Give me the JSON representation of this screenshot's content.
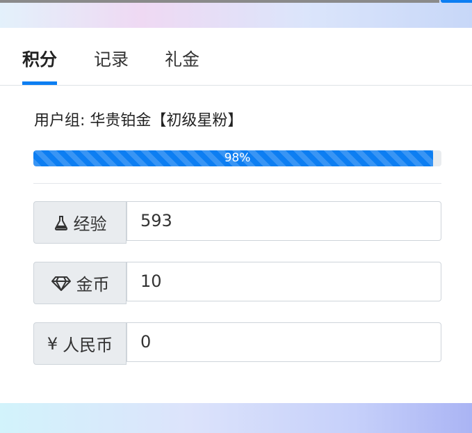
{
  "tabs": [
    {
      "label": "积分",
      "active": true
    },
    {
      "label": "记录",
      "active": false
    },
    {
      "label": "礼金",
      "active": false
    }
  ],
  "user_group": "用户组: 华贵铂金【初级星粉】",
  "progress": {
    "value": 98,
    "label": "98%"
  },
  "stats": [
    {
      "icon": "flask-icon",
      "label": "经验",
      "value": "593"
    },
    {
      "icon": "diamond-icon",
      "label": "金币",
      "value": "10"
    },
    {
      "icon": "yen-icon",
      "icon_glyph": "¥",
      "label": "人民币",
      "value": "0"
    }
  ],
  "colors": {
    "accent": "#0d7ef2",
    "addon_bg": "#e9ecef",
    "border": "#ced4da"
  }
}
